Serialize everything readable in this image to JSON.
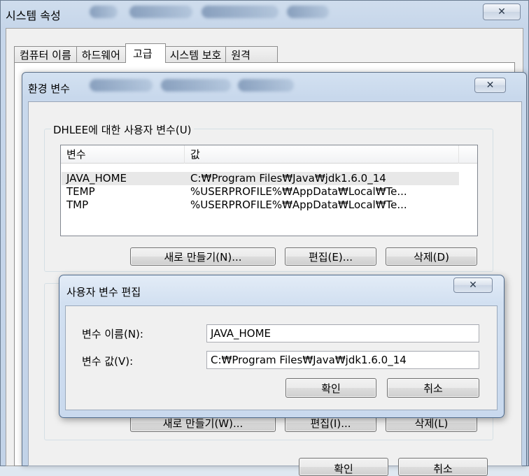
{
  "system_properties": {
    "title": "시스템 속성",
    "tabs": [
      "컴퓨터 이름",
      "하드웨어",
      "고급",
      "시스템 보호",
      "원격"
    ],
    "active_tab": "고급"
  },
  "env_window": {
    "title": "환경 변수",
    "user_group_label": "DHLEE에 대한 사용자 변수(U)",
    "columns": [
      "변수",
      "값"
    ],
    "rows": [
      {
        "name": "JAVA_HOME",
        "value": "C:₩Program Files₩Java₩jdk1.6.0_14",
        "selected": true
      },
      {
        "name": "TEMP",
        "value": "%USERPROFILE%₩AppData₩Local₩Te...",
        "selected": false
      },
      {
        "name": "TMP",
        "value": "%USERPROFILE%₩AppData₩Local₩Te...",
        "selected": false
      }
    ],
    "user_buttons": {
      "new": "새로 만들기(N)...",
      "edit": "편집(E)...",
      "delete": "삭제(D)"
    },
    "system_buttons": {
      "new": "새로 만들기(W)...",
      "edit": "편집(I)...",
      "delete": "삭제(L)"
    },
    "bottom_buttons": {
      "ok": "확인",
      "cancel": "취소"
    }
  },
  "edit_dialog": {
    "title": "사용자 변수 편집",
    "name_label": "변수 이름(N):",
    "value_label": "변수 값(V):",
    "name_value": "JAVA_HOME",
    "value_value": "C:₩Program Files₩Java₩jdk1.6.0_14",
    "ok": "확인",
    "cancel": "취소"
  },
  "icons": {
    "close": "close-icon"
  }
}
